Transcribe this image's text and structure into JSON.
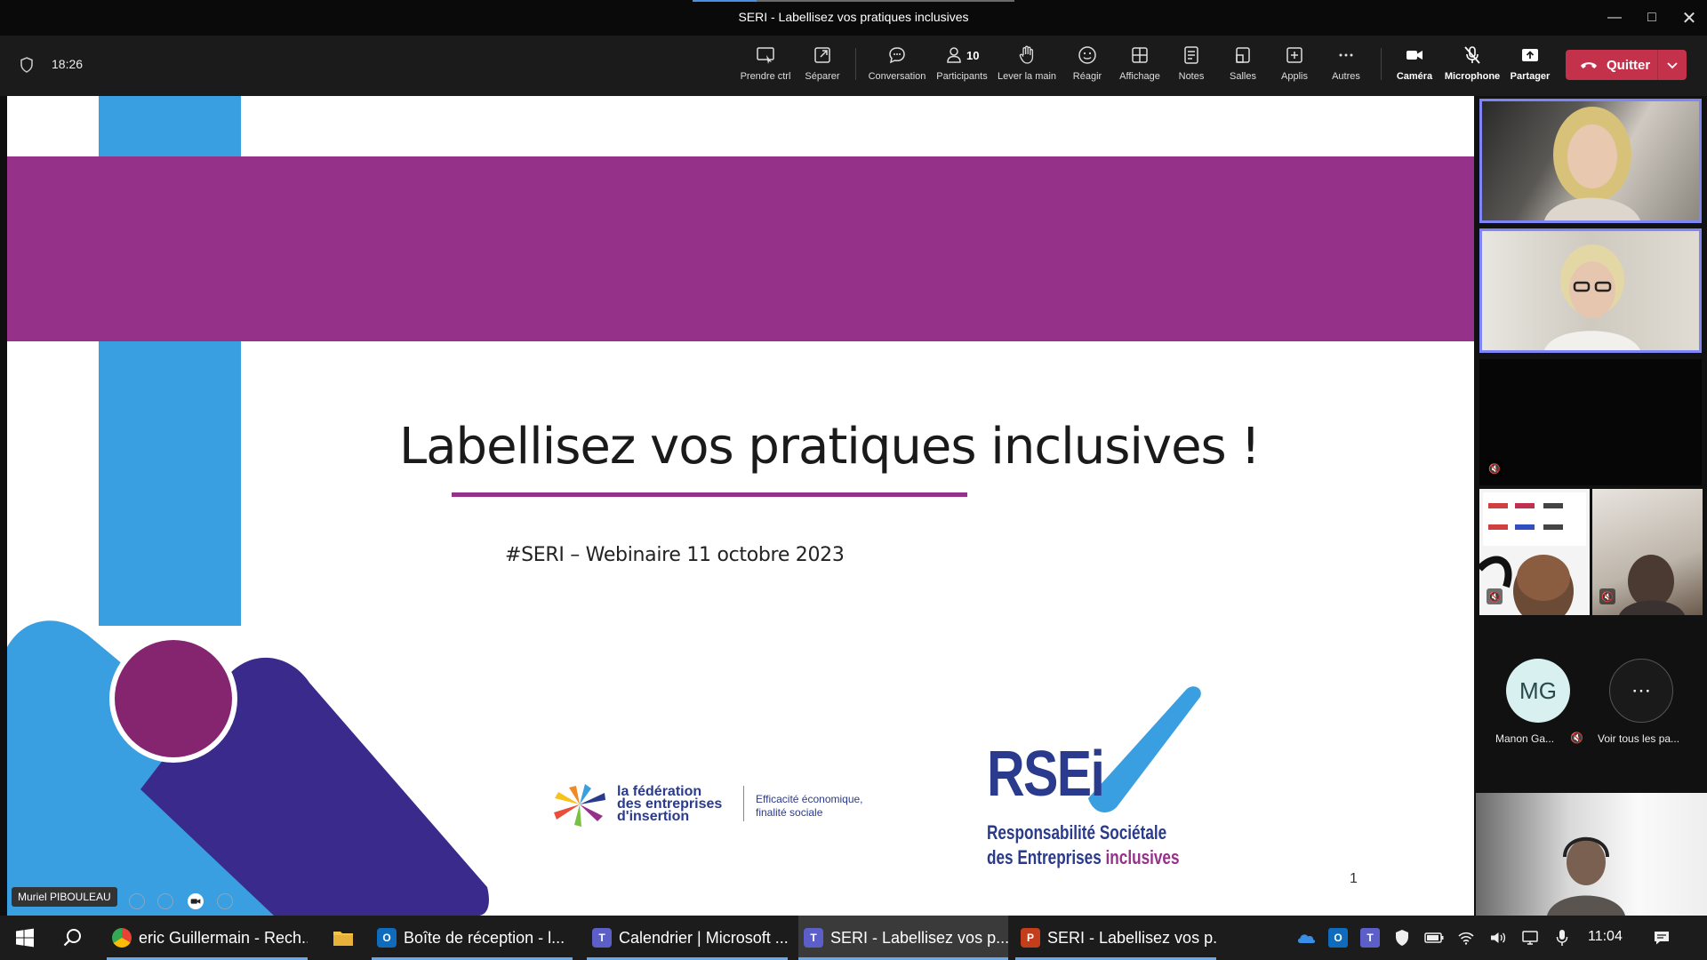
{
  "window": {
    "title": "SERI - Labellisez vos pratiques inclusives",
    "min_icon": "minimize-icon",
    "max_icon": "maximize-icon",
    "close_icon": "close-icon"
  },
  "meeting_toolbar": {
    "elapsed": "18:26",
    "participants_count": "10",
    "buttons": {
      "take_control": "Prendre ctrl",
      "pop_out": "Séparer",
      "chat": "Conversation",
      "participants": "Participants",
      "raise_hand": "Lever la main",
      "react": "Réagir",
      "view": "Affichage",
      "notes": "Notes",
      "rooms": "Salles",
      "apps": "Applis",
      "more": "Autres",
      "camera": "Caméra",
      "microphone": "Microphone",
      "share": "Partager"
    },
    "leave_label": "Quitter",
    "colors": {
      "leave": "#c4314b",
      "accent": "#7f85f5"
    }
  },
  "slide": {
    "title": "Labellisez vos pratiques inclusives !",
    "subtitle": "#SERI – Webinaire 11 octobre 2023",
    "page_number": "1",
    "fei_logo": {
      "line1": "la fédération",
      "line2": "des entreprises",
      "line3": "d'insertion",
      "tagline1": "Efficacité économique,",
      "tagline2": "finalité sociale"
    },
    "rsei_logo": {
      "word": "RSEi",
      "line1": "Responsabilité Sociétale",
      "line2_main": "des Entreprises ",
      "line2_accent": "inclusives"
    },
    "colors": {
      "purple": "#96318a",
      "blue": "#3a9fe0",
      "navy": "#2a3a8c"
    }
  },
  "stage": {
    "speaker_name": "Muriel PIBOULEAU"
  },
  "participants_rail": {
    "avatar_initials": "MG",
    "avatar_name": "Manon Ga...",
    "see_all_label": "Voir tous les pa..."
  },
  "taskbar": {
    "items": [
      {
        "label": "eric Guillermain - Rech...",
        "icon": "chrome-icon"
      },
      {
        "label": "Boîte de réception - l...",
        "icon": "outlook-icon"
      },
      {
        "label": "Calendrier | Microsoft ...",
        "icon": "teams-icon"
      },
      {
        "label": "SERI - Labellisez vos p...",
        "icon": "teams-icon"
      },
      {
        "label": "SERI - Labellisez vos p...",
        "icon": "powerpoint-icon"
      }
    ],
    "time": "11:04"
  }
}
